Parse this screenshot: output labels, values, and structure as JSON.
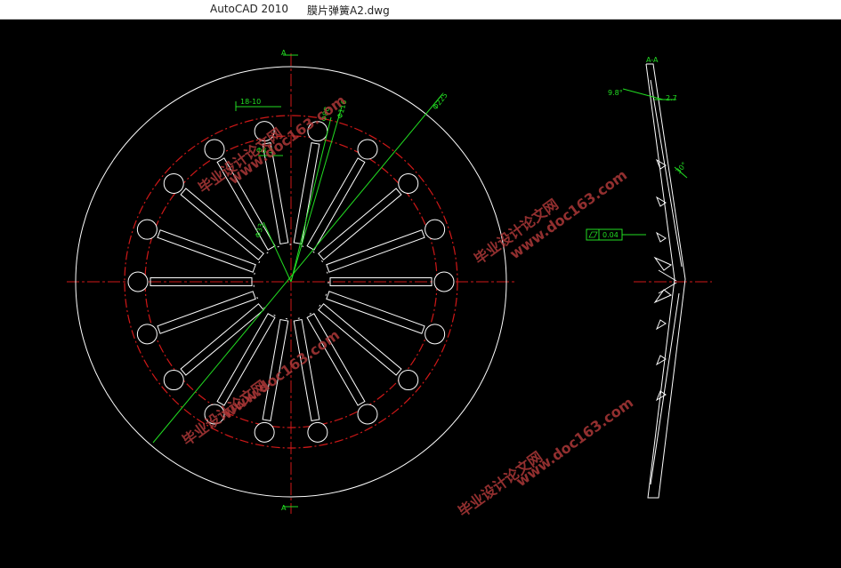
{
  "window": {
    "app_name": "AutoCAD 2010",
    "file_name": "膜片弹簧A2.dwg"
  },
  "colors": {
    "background": "#000000",
    "geometry": "#ffffff",
    "centerline": "#d01818",
    "dimension": "#22dd22",
    "watermark": "#b23a3a"
  },
  "drawing": {
    "section_mark_top": "A",
    "section_mark_bottom": "A",
    "section_view_label": "A-A",
    "dim_slot_width": "18-10",
    "dim_inner_1": "Φ88",
    "dim_inner_2": "Φ116",
    "dim_outer": "Φ225",
    "dim_center": "Φ33",
    "dim_slot_small": "Φ8.5",
    "dim_angle_1": "9.8°",
    "dim_thickness": "2.7",
    "dim_angle_2": "30°",
    "flatness_value": "0.04"
  },
  "watermarks": [
    {
      "text": "毕业设计论文网"
    },
    {
      "text": "www.doc163.com"
    }
  ]
}
